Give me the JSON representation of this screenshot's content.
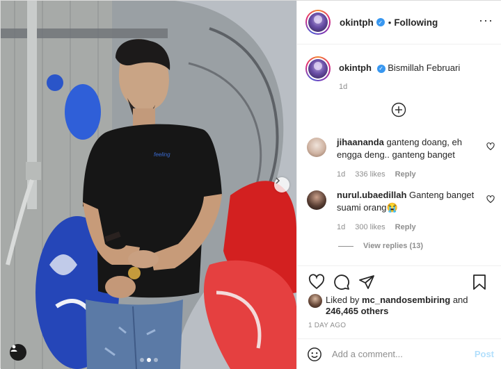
{
  "post": {
    "author": "okintph",
    "verified": true,
    "separator": "•",
    "follow_status": "Following",
    "more_icon": "more-horizontal-icon",
    "caption": "Bismillah Februari",
    "caption_age": "1d",
    "load_more_icon": "plus-circle-icon"
  },
  "comments": [
    {
      "username": "jihaananda",
      "text": "ganteng doang, eh engga deng.. ganteng banget",
      "age": "1d",
      "likes": "336 likes",
      "reply_label": "Reply",
      "avatar_color": "#d9c4b8"
    },
    {
      "username": "nurul.ubaedillah",
      "text": "Ganteng banget suami orang😭",
      "age": "1d",
      "likes": "300 likes",
      "reply_label": "Reply",
      "avatar_color": "#3b2b26",
      "view_replies": "View replies (13)"
    }
  ],
  "actions": {
    "like_icon": "heart-icon",
    "comment_icon": "comment-icon",
    "share_icon": "paper-plane-icon",
    "save_icon": "bookmark-icon",
    "liked_prefix": "Liked by",
    "liked_user": "mc_nandosembiring",
    "liked_and": "and",
    "liked_others": "246,465 others",
    "date": "1 DAY AGO"
  },
  "composer": {
    "emoji_icon": "smiley-icon",
    "placeholder": "Add a comment...",
    "post_label": "Post"
  },
  "carousel": {
    "next_icon": "chevron-right-icon",
    "tag_icon": "user-tag-icon",
    "slide_count": 3,
    "active_index": 1
  },
  "colors": {
    "verified_blue": "#3897f0",
    "muted_text": "#8e8e8e",
    "post_disabled": "#b2dffc"
  }
}
